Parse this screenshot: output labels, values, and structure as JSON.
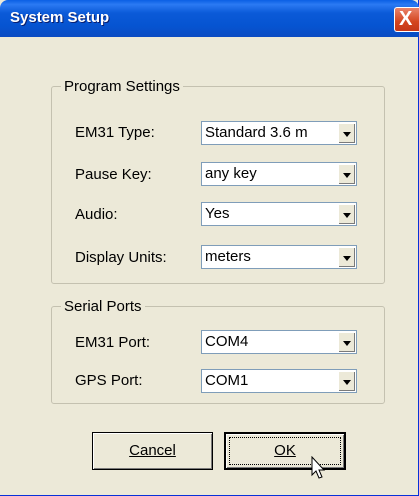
{
  "window": {
    "title": "System Setup",
    "close_glyph": "X"
  },
  "program_settings": {
    "legend": "Program Settings",
    "rows": [
      {
        "label": "EM31 Type:",
        "value": "Standard 3.6 m"
      },
      {
        "label": "Pause Key:",
        "value": "any key"
      },
      {
        "label": "Audio:",
        "value": "Yes"
      },
      {
        "label": "Display Units:",
        "value": "meters"
      }
    ]
  },
  "serial_ports": {
    "legend": "Serial Ports",
    "rows": [
      {
        "label": "EM31 Port:",
        "value": "COM4"
      },
      {
        "label": "GPS Port:",
        "value": "COM1"
      }
    ]
  },
  "buttons": {
    "cancel": "Cancel",
    "ok": "OK"
  },
  "icons": {
    "close": "close-icon",
    "dropdown": "chevron-down-icon",
    "cursor": "mouse-pointer-icon"
  }
}
